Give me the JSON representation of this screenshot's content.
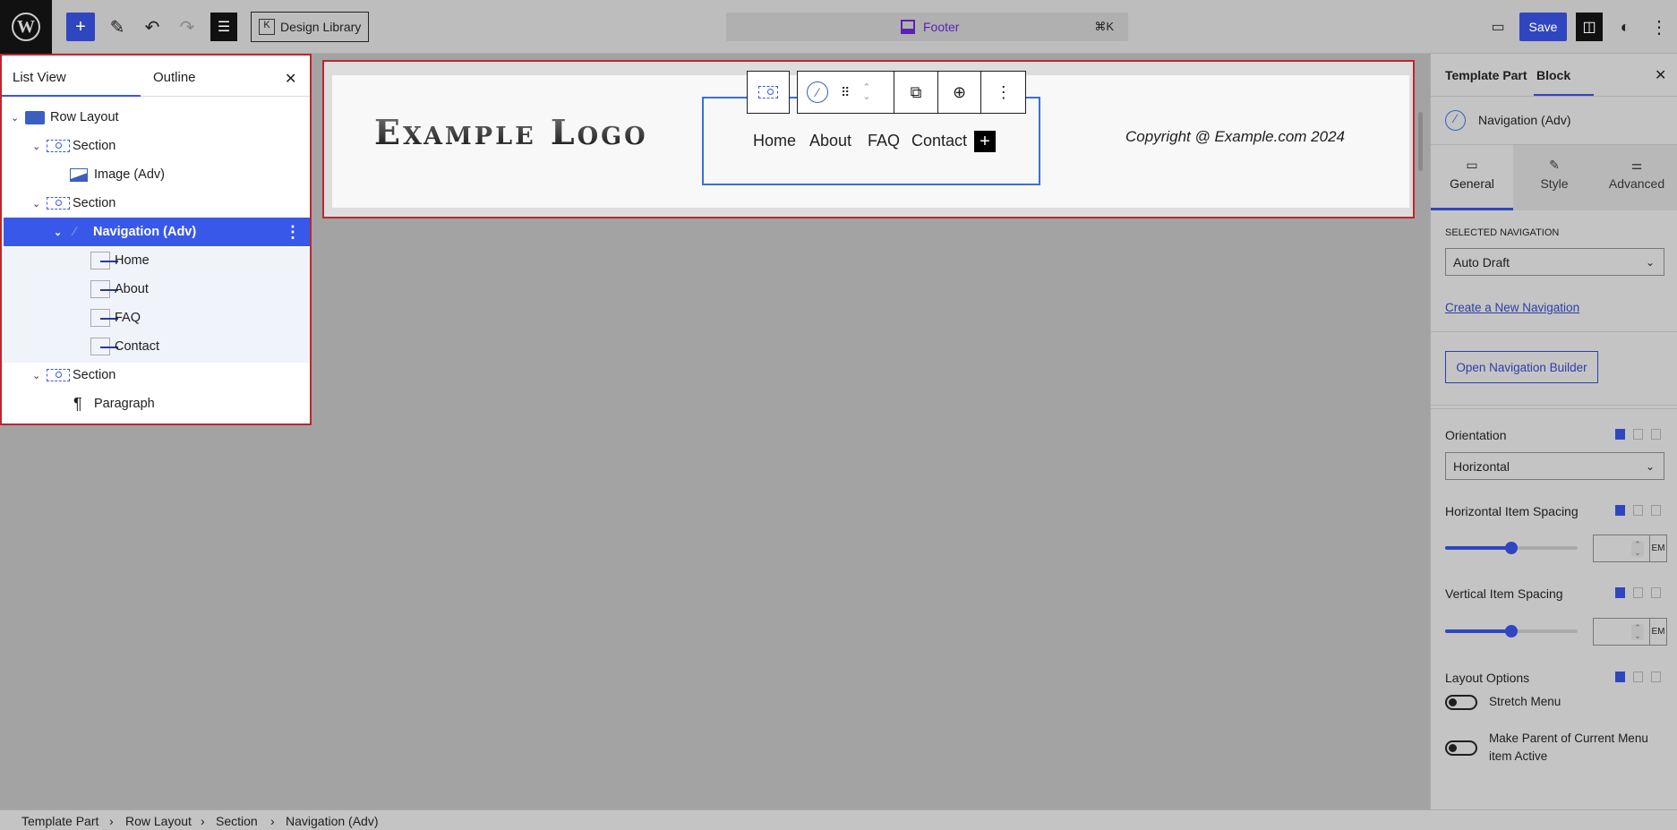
{
  "topbar": {
    "design_library": "Design Library",
    "document_title": "Footer",
    "shortcut": "⌘K",
    "save": "Save"
  },
  "list_view": {
    "tabs": [
      "List View",
      "Outline"
    ],
    "active_tab": "List View",
    "items": [
      {
        "label": "Row Layout",
        "icon": "row-layout-icon"
      },
      {
        "label": "Section",
        "icon": "section-icon"
      },
      {
        "label": "Image (Adv)",
        "icon": "image-icon"
      },
      {
        "label": "Section",
        "icon": "section-icon"
      },
      {
        "label": "Navigation (Adv)",
        "icon": "navigation-icon",
        "selected": true
      },
      {
        "label": "Home",
        "icon": "nav-link-icon"
      },
      {
        "label": "About",
        "icon": "nav-link-icon"
      },
      {
        "label": "FAQ",
        "icon": "nav-link-icon"
      },
      {
        "label": "Contact",
        "icon": "nav-link-icon"
      },
      {
        "label": "Section",
        "icon": "section-icon"
      },
      {
        "label": "Paragraph",
        "icon": "paragraph-icon"
      }
    ]
  },
  "canvas": {
    "logo": "Example Logo",
    "nav_items": [
      "Home",
      "About",
      "FAQ",
      "Contact"
    ],
    "copyright": "Copyright @ Example.com 2024"
  },
  "inspector": {
    "tabs": [
      "Template Part",
      "Block"
    ],
    "active_tab": "Block",
    "block_name": "Navigation (Adv)",
    "subtabs": [
      "General",
      "Style",
      "Advanced"
    ],
    "active_subtab": "General",
    "selected_navigation_label": "SELECTED NAVIGATION",
    "selected_navigation": "Auto Draft",
    "create_link": "Create a New Navigation",
    "open_builder": "Open Navigation Builder",
    "orientation_label": "Orientation",
    "orientation": "Horizontal",
    "h_spacing_label": "Horizontal Item Spacing",
    "h_spacing_unit": "EM",
    "h_spacing_slider_percent": 50,
    "v_spacing_label": "Vertical Item Spacing",
    "v_spacing_unit": "EM",
    "v_spacing_slider_percent": 50,
    "layout_label": "Layout Options",
    "stretch_menu": "Stretch Menu",
    "stretch_menu_on": false,
    "make_parent": "Make Parent of Current Menu",
    "make_parent_2": "item Active",
    "make_parent_on": false
  },
  "breadcrumb": [
    "Template Part",
    "Row Layout",
    "Section",
    "Navigation (Adv)"
  ],
  "colors": {
    "accent": "#3858e9",
    "selection_border": "#c0262d",
    "command_text": "#5b21b6"
  }
}
